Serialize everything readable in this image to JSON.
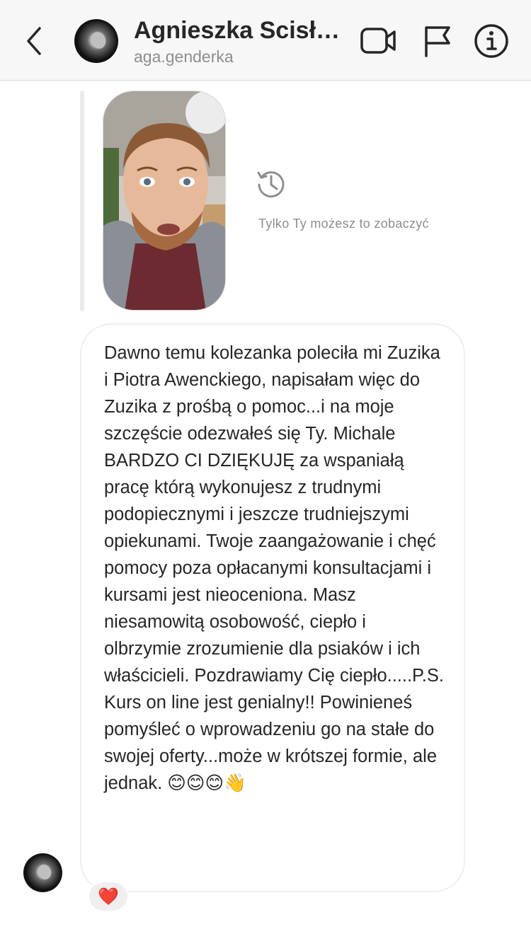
{
  "header": {
    "name": "Agnieszka Scisło...",
    "username": "aga.genderka",
    "icons": [
      "back-arrow-icon",
      "video-call-icon",
      "flag-icon",
      "info-icon"
    ]
  },
  "story_reply": {
    "icon": "history-icon",
    "visibility_note": "Tylko Ty możesz to zobaczyć"
  },
  "message": {
    "text": "Dawno temu kolezanka poleciła mi Zuzika i Piotra Awenckiego, napisałam więc do Zuzika z prośbą o pomoc...i na moje szczęście odezwałeś się Ty. Michale BARDZO CI DZIĘKUJĘ za wspaniałą pracę którą wykonujesz z trudnymi podopiecznymi i jeszcze trudniejszymi opiekunami. Twoje zaangażowanie i chęć pomocy poza opłacanymi konsultacjami i kursami jest nieoceniona. Masz niesamowitą osobowość, ciepło i olbrzymie zrozumienie dla psiaków i ich właścicieli. Pozdrawiamy Cię ciepło.....P.S. Kurs on line jest genialny!! Powinieneś pomyśleć o wprowadzeniu go na stałe do swojej oferty...może w krótszej formie, ale jednak. 😊😊😊👋",
    "reaction": "❤️"
  },
  "colors": {
    "header_bg": "#f7f7f7",
    "secondary_text": "#8e8e8e",
    "bubble_border": "#efefef",
    "heart": "#ed4956"
  }
}
